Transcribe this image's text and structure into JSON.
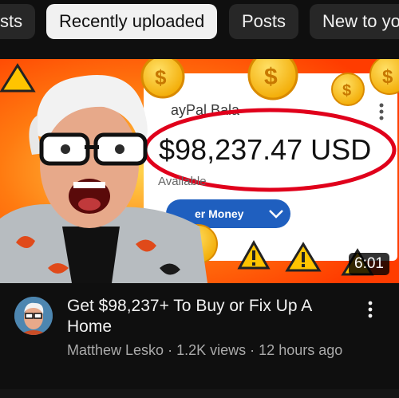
{
  "chips": [
    {
      "label": "sts",
      "active": false
    },
    {
      "label": "Recently uploaded",
      "active": true
    },
    {
      "label": "Posts",
      "active": false
    },
    {
      "label": "New to yo",
      "active": false
    }
  ],
  "thumbnail": {
    "balance_title": "ayPal Bala",
    "amount": "$98,237.47 USD",
    "available": "Available",
    "button_label": "er Money",
    "duration": "6:01"
  },
  "video": {
    "title": "Get $98,237+ To Buy or Fix Up A Home",
    "channel": "Matthew Lesko",
    "views": "1.2K views",
    "age": "12 hours ago",
    "separator": "·"
  },
  "colors": {
    "background": "#0f0f0f",
    "chip": "#272727",
    "chip_active": "#f1f1f1",
    "meta_text": "#aaaaaa",
    "thumb_red_circle": "#e0001b"
  },
  "icons": {
    "more": "vertical-dots-icon"
  }
}
